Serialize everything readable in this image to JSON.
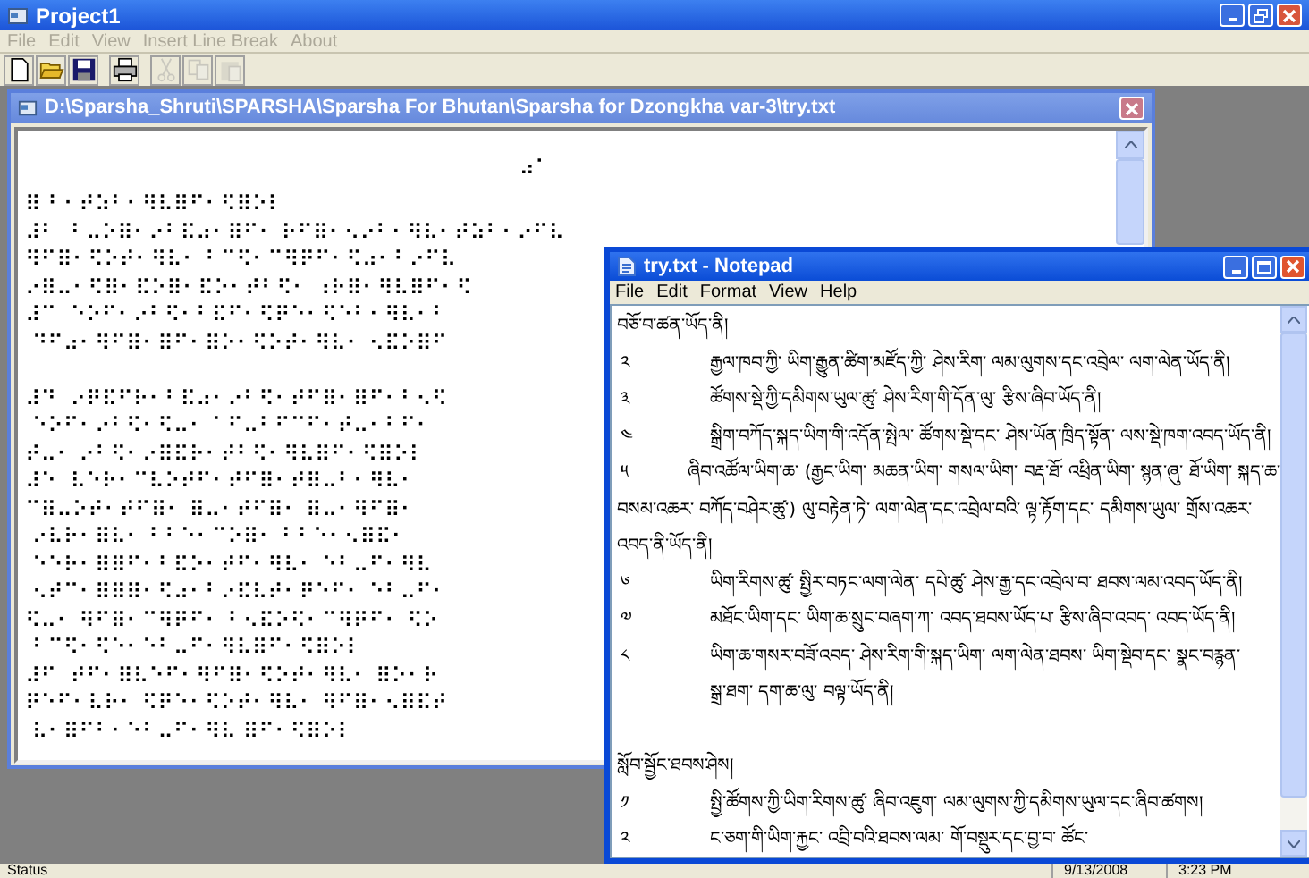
{
  "app": {
    "title": "Project1",
    "menu": [
      {
        "label": "File",
        "disabled": true
      },
      {
        "label": "Edit",
        "disabled": true
      },
      {
        "label": "View",
        "disabled": true
      },
      {
        "label": "Insert Line Break",
        "disabled": true
      },
      {
        "label": "About",
        "disabled": true
      }
    ],
    "toolbar": [
      {
        "kind": "new",
        "disabled": false
      },
      {
        "kind": "open",
        "disabled": false
      },
      {
        "kind": "save",
        "disabled": false
      },
      {
        "kind": "sep"
      },
      {
        "kind": "print",
        "disabled": false
      },
      {
        "kind": "sep"
      },
      {
        "kind": "cut",
        "disabled": true
      },
      {
        "kind": "copy",
        "disabled": true
      },
      {
        "kind": "paste",
        "disabled": true
      }
    ]
  },
  "document_window": {
    "title": "D:\\Sparsha_Shruti\\SPARSHA\\Sparsha For Bhutan\\Sparsha for Dzongkha var-3\\try.txt",
    "header": "⠴⠁",
    "paragraphs": [
      [
        "⠿ ⠃⠂⠞⠵⠃⠂⠻⠧⠿⠋⠂⠫⠿⠕⠇",
        "⠼⠃  ⠃⠤⠕⠿⠂⠔⠃⠯⠴⠂⠿⠋⠂ ⠗⠋⠿⠂⠢⠔⠃⠂⠻⠧⠂⠞⠵⠃⠂⠔⠋⠧",
        "⠻⠋⠿⠂⠫⠕⠞⠂⠻⠧⠂ ⠃⠉⠫⠂⠉⠻⠟⠋⠂⠫⠴⠂⠃⠔⠋⠧",
        "⠔⠿⠤⠂⠫⠿⠂⠯⠕⠿⠂⠯⠕⠂⠞⠃⠫⠂ ⠰⠗⠿⠂⠻⠧⠿⠋⠂⠫",
        "⠼⠉  ⠑⠕⠋⠂⠔⠃⠫⠂⠃⠯⠋⠂⠫⠟⠑⠂⠫⠑⠃⠂⠻⠧⠂⠃",
        " ⠙⠋⠴⠂⠻⠋⠿⠂⠿⠋⠂⠿⠕⠂⠫⠕⠞⠂⠻⠧⠂ ⠢⠯⠕⠿⠋"
      ],
      [
        "⠼⠙  ⠔⠟⠯⠋⠗⠂⠃⠯⠴⠂⠔⠃⠫⠂⠞⠋⠿⠂⠿⠋⠂⠃⠢⠫",
        " ⠑⠕⠋⠂⠔⠃⠫⠂⠫⠤⠂ ⠁⠋⠤⠃⠋⠉⠋⠂⠞⠤⠂⠃⠋⠂",
        "⠞⠤⠂ ⠔⠃⠫⠂⠔⠿⠯⠗⠂⠞⠃⠫⠂⠻⠧⠿⠋⠂⠫⠿⠕⠇",
        "⠼⠑  ⠧⠑⠗⠂⠉⠧⠕⠞⠋⠂⠞⠋⠿⠂⠞⠿⠤⠃⠂⠻⠧⠂",
        "⠉⠿⠤⠕⠞⠂⠞⠋⠿⠂ ⠿⠤⠂⠞⠋⠿⠂ ⠿⠤⠂⠻⠋⠿⠂",
        " ⠔⠧⠗⠂⠿⠧⠂ ⠃⠃⠑⠂⠉⠕⠿⠂ ⠃⠃⠑⠂⠢⠿⠯⠂",
        " ⠑⠑⠗⠂⠿⠿⠋⠂⠃⠯⠕⠂⠞⠋⠂⠻⠧⠂ ⠑⠃⠤⠋⠂⠻⠧",
        " ⠢⠞⠉⠂⠿⠿⠿⠂⠫⠴⠂⠃⠔⠯⠧⠞⠂⠟⠑⠋⠂ ⠑⠃⠤⠋⠂",
        "⠫⠤⠂ ⠻⠋⠿⠂⠉⠻⠟⠋⠂ ⠃⠢⠯⠕⠫⠂⠉⠻⠟⠋⠂ ⠫⠕",
        " ⠃⠉⠫⠂⠫⠑⠂⠑⠃⠤⠋⠂⠻⠧⠿⠋⠂⠫⠿⠕⠇",
        "⠼⠋  ⠞⠋⠂⠿⠧⠑⠋⠂⠻⠋⠿⠂⠫⠕⠞⠂⠻⠧⠂ ⠿⠕⠂⠗",
        "⠟⠑⠋⠂⠧⠗⠂ ⠫⠟⠑⠂⠫⠕⠞⠂⠻⠧⠂ ⠻⠋⠿⠂⠢⠿⠯⠞",
        " ⠧⠂⠿⠋⠃⠂⠑⠃⠤⠋⠂⠻⠧ ⠿⠋⠂⠫⠿⠕⠇"
      ]
    ]
  },
  "notepad": {
    "title": "try.txt - Notepad",
    "menu": [
      "File",
      "Edit",
      "Format",
      "View",
      "Help"
    ],
    "lines": [
      {
        "kind": "heading",
        "text": "བཅོ་བ་ཚན་ཡོད་ནི།"
      },
      {
        "kind": "item",
        "number": "༢",
        "text": "རྒྱལ་ཁབ་ཀྱི་ ཡིག་རྒྱུན་ཚིག་མཛོད་ཀྱི་ ཤེས་རིག་ ལམ་ལུགས་དང་འབྲེལ་ ལག་ལེན་ཡོད་ནི།"
      },
      {
        "kind": "item",
        "number": "༣",
        "text": "ཚོགས་སྡེ་ཀྱི་དམིགས་ཡུལ་ཚུ་ ཤེས་རིག་གི་དོན་ལུ་ རྩིས་ཞིབ་ཡོད་ནི།"
      },
      {
        "kind": "item",
        "number": "༤",
        "text": "སྒྲིག་བཀོད་སྐད་ཡིག་གི་འདོན་སྤེལ་ ཚོགས་སྡེ་དང་ ཤེས་ཡོན་ཁྲིད་སྟོན་ ལས་སྡེ་ཁག་འབད་ཡོད་ནི།"
      },
      {
        "kind": "item",
        "number": "༥",
        "text": "ཞིབ་འཚོལ་ཡིག་ཆ་ (རྒྱང་ཡིག་ མཆན་ཡིག་ གསལ་ཡིག་ བརྡ་ཐོ་ འཕྲིན་ཡིག་ སྙན་ཞུ་ ཐོ་ཡིག་ སྐད་ཆ་"
      },
      {
        "kind": "continuation",
        "text": "བསམ་འཆར་ བཀོད་བཤེར་ཚུ་) ལུ་བརྟེན་ཏེ་ ལག་ལེན་དང་འབྲེལ་བའི་ ལྟ་རྟོག་དང་ དམིགས་ཡུལ་ གྲོས་འཆར་"
      },
      {
        "kind": "continuation",
        "text": "འབད་ནི་ཡོད་ནི།"
      },
      {
        "kind": "item",
        "number": "༦",
        "text": "ཡིག་རིགས་ཚུ་ སྤྱིར་བཏང་ལག་ལེན་ དཔེ་ཚུ་ ཤེས་རྒྱ་དང་འབྲེལ་བ་ ཐབས་ལམ་འབད་ཡོད་ནི།"
      },
      {
        "kind": "item",
        "number": "༧",
        "text": "མཐོང་ཡིག་དང་ ཡིག་ཆ་སྲུང་བཞག་ཀ་ འབད་ཐབས་ཡོད་པ་ རྩིས་ཞིབ་འབད་ འབད་ཡོད་ནི།"
      },
      {
        "kind": "item",
        "number": "༨",
        "text": "ཡིག་ཆ་གསར་བཟོ་འབད་ ཤེས་རིག་གི་སྐད་ཡིག་ ལག་ལེན་ཐབས་ ཡིག་སྡེབ་དང་ སྣང་བརྙན་"
      },
      {
        "kind": "indent",
        "text": "སྒྲ་ཐག་ དག་ཆ་ལུ་ བལྟ་ཡོད་ནི།"
      },
      {
        "kind": "blank"
      },
      {
        "kind": "heading",
        "text": "སློབ་སྦྱོང་ཐབས་ཤེས།"
      },
      {
        "kind": "item",
        "number": "༡",
        "text": "སྤྱི་ཚོགས་ཀྱི་ཡིག་རིགས་ཚུ་ ཞིབ་འཇུག་ ལམ་ལུགས་ཀྱི་དམིགས་ཡུལ་དང་ཞིབ་ཚགས།"
      },
      {
        "kind": "item",
        "number": "༢",
        "text": "ང་ཅག་གི་ཡིག་རྐྱང་ འབྲི་བའི་ཐབས་ལམ་ གོ་བསྡུར་དང་བྱ་བ་ ཚོང་"
      }
    ]
  },
  "status_bar": {
    "status": "Status",
    "date": "9/13/2008",
    "time": "3:23 PM"
  }
}
